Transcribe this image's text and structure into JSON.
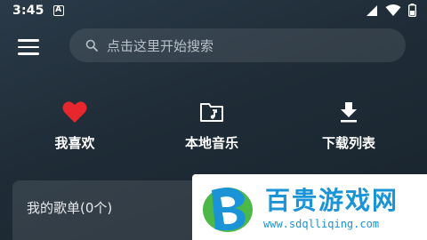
{
  "status_bar": {
    "time": "3:45",
    "notification_letter": "A"
  },
  "search": {
    "placeholder": "点击这里开始搜索"
  },
  "quick_actions": [
    {
      "label": "我喜欢",
      "icon": "heart-icon",
      "color": "#e8262e"
    },
    {
      "label": "本地音乐",
      "icon": "folder-music-icon"
    },
    {
      "label": "下载列表",
      "icon": "download-icon"
    }
  ],
  "playlist": {
    "title": "我的歌单(0个)"
  },
  "watermark": {
    "name": "百贵游戏网",
    "url": "www.sdqlliqing.com",
    "color": "#1a94d6"
  }
}
